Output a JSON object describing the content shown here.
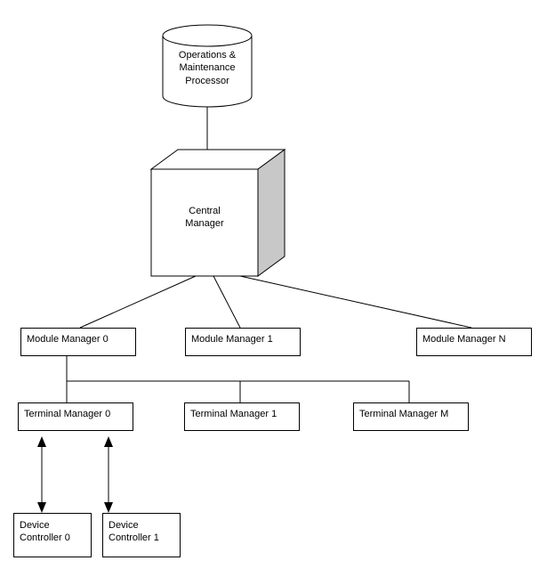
{
  "diagram": {
    "omp": {
      "line1": "Operations &",
      "line2": "Maintenance",
      "line3": "Processor"
    },
    "central": {
      "line1": "Central",
      "line2": "Manager"
    },
    "modules": {
      "m0": "Module Manager 0",
      "m1": "Module Manager 1",
      "mN": "Module Manager N"
    },
    "terminals": {
      "t0": "Terminal Manager 0",
      "t1": "Terminal Manager 1",
      "tM": "Terminal Manager M"
    },
    "devices": {
      "d0": {
        "line1": "Device",
        "line2": "Controller 0"
      },
      "d1": {
        "line1": "Device",
        "line2": "Controller 1"
      }
    }
  }
}
